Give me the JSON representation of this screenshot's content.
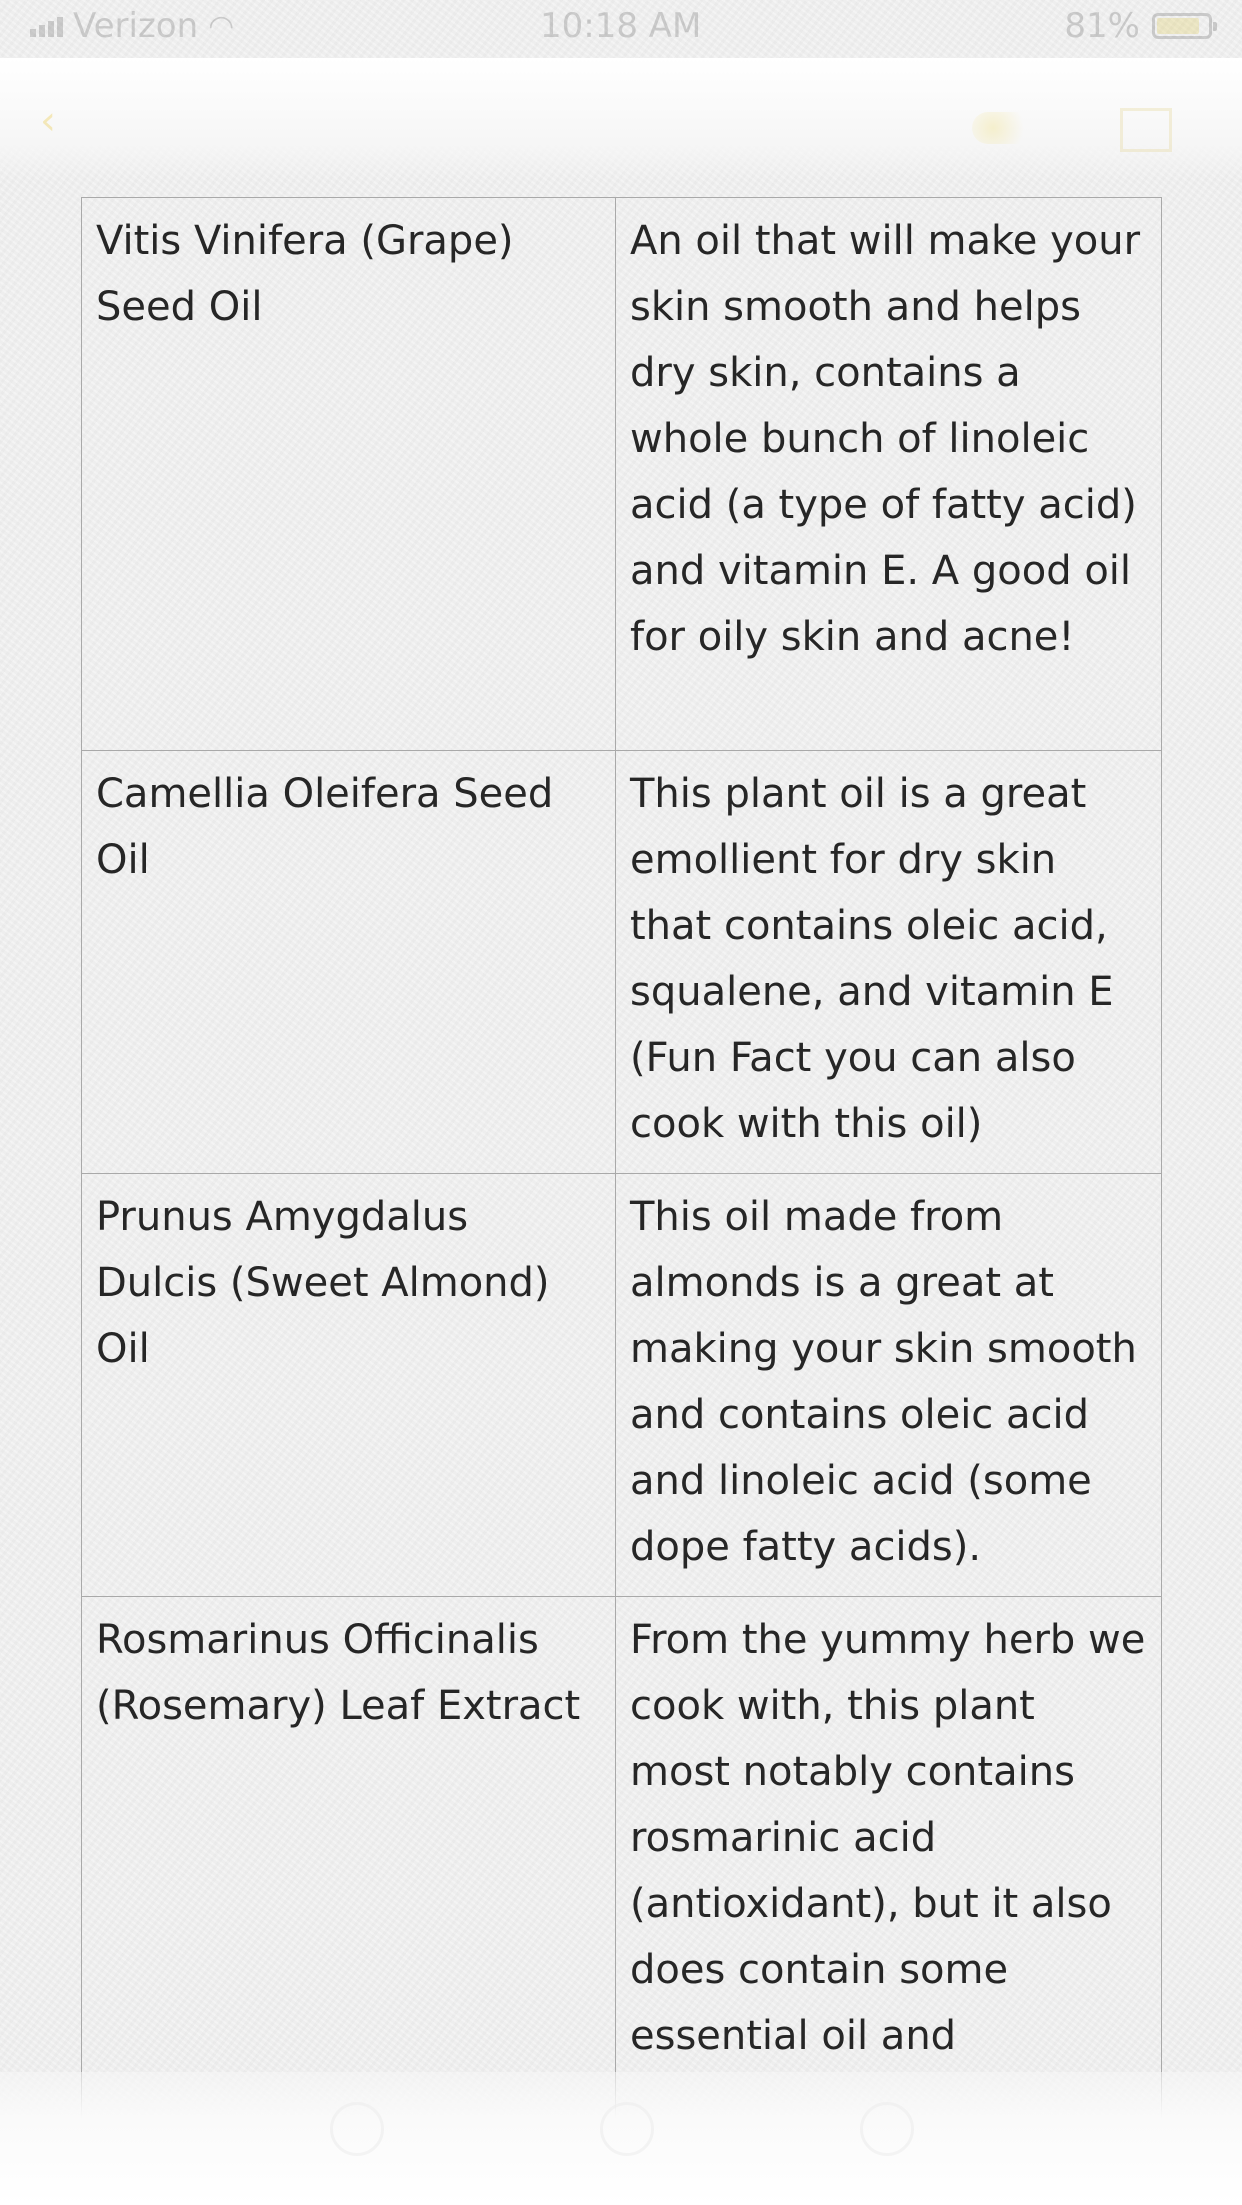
{
  "status_bar": {
    "carrier": "Verizon",
    "time": "10:18 AM",
    "battery": "81%"
  },
  "colors": {
    "text": "#262626",
    "grid": "#a9a9a9",
    "accent": "#e6b800"
  },
  "table": {
    "rows": [
      {
        "name": "Vitis Vinifera (Grape) Seed Oil",
        "description": "An oil that will make your skin smooth and helps dry skin, contains a whole bunch of linoleic acid (a type of fatty acid) and vitamin E. A good oil for oily skin and acne!"
      },
      {
        "name": "Camellia Oleifera Seed Oil",
        "description": "This plant oil is a great emollient for dry skin that contains oleic acid, squalene, and vitamin E (Fun Fact you can also cook with this oil)"
      },
      {
        "name": "Prunus Amygdalus Dulcis (Sweet Almond) Oil",
        "description": "This oil made from almonds is a great at making your skin smooth and contains oleic acid and linoleic acid (some dope fatty acids)."
      },
      {
        "name": "Rosmarinus Officinalis (Rosemary) Leaf Extract",
        "description": "From the yummy herb we cook with, this plant most notably contains rosmarinic acid (antioxidant), but it also does contain some essential oil and"
      }
    ]
  },
  "icons": {
    "back": "chevron-left-icon",
    "more": "more-icon",
    "compose": "compose-icon",
    "wifi": "wifi-icon",
    "signal": "signal-icon",
    "battery": "battery-icon"
  }
}
